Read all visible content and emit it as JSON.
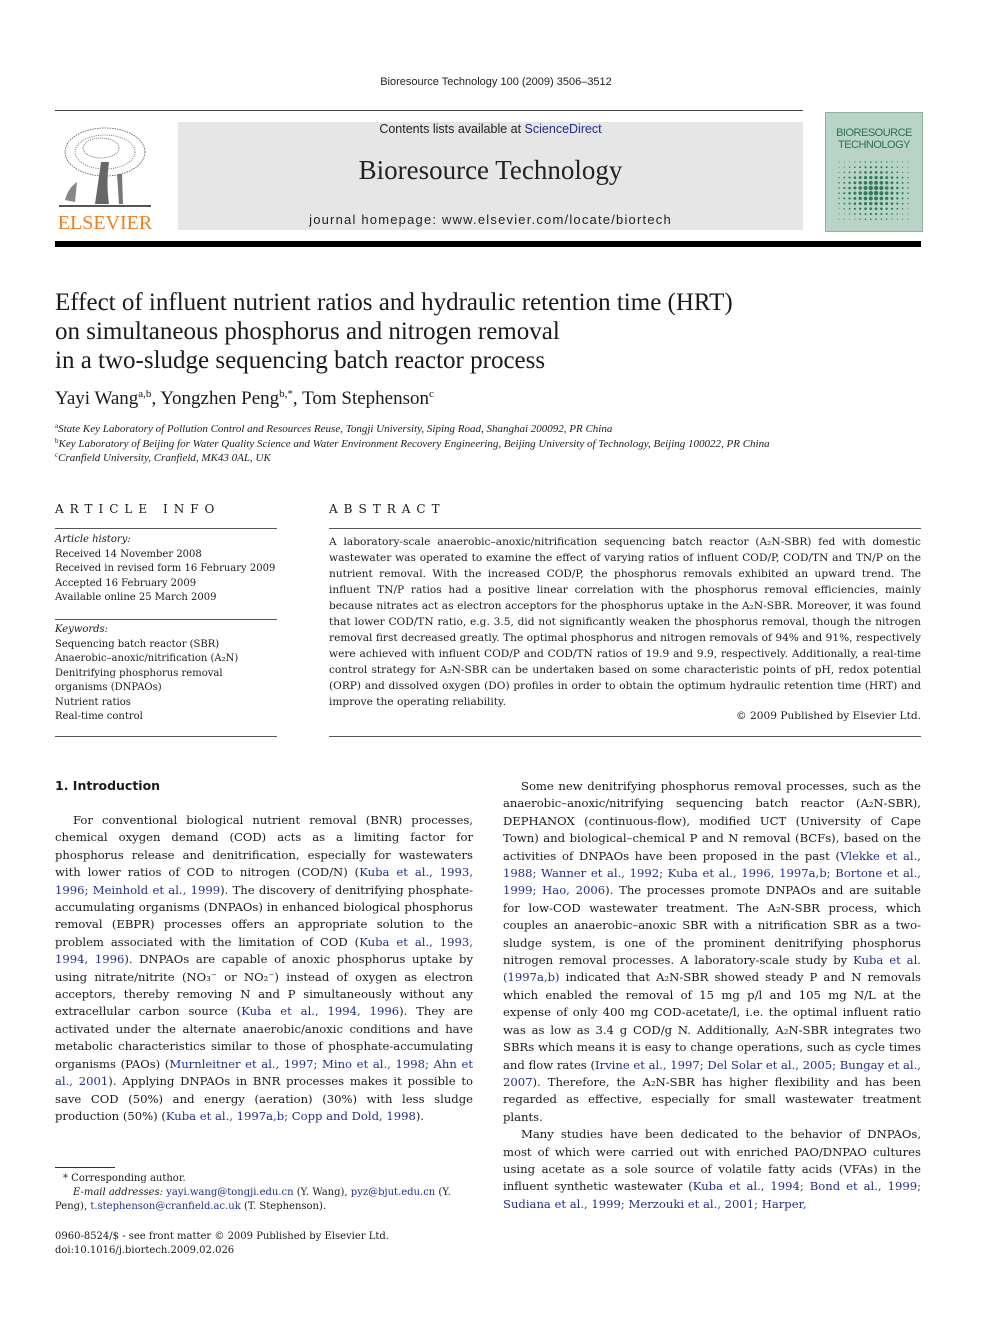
{
  "header": {
    "running_head": "Bioresource Technology 100 (2009) 3506–3512",
    "contents_prefix": "Contents lists available at ",
    "contents_link": "ScienceDirect",
    "journal_title": "Bioresource Technology",
    "homepage": "journal homepage: www.elsevier.com/locate/biortech",
    "publisher_logo_text": "ELSEVIER",
    "cover_title_line1": "BIORESOURCE",
    "cover_title_line2": "TECHNOLOGY",
    "colors": {
      "publisher_orange": "#f07f1c",
      "link_blue": "#1f2f8a",
      "cover_green": "#b7d4c6"
    }
  },
  "article": {
    "title_lines": [
      "Effect of influent nutrient ratios and hydraulic retention time (HRT)",
      "on simultaneous phosphorus and nitrogen removal",
      "in a two-sludge sequencing batch reactor process"
    ],
    "authors": [
      {
        "name": "Yayi Wang",
        "marks": "a,b",
        "sep": ", "
      },
      {
        "name": "Yongzhen Peng",
        "marks": "b,*",
        "sep": ", "
      },
      {
        "name": "Tom Stephenson",
        "marks": "c",
        "sep": ""
      }
    ],
    "affiliations": [
      {
        "mark": "a",
        "text": "State Key Laboratory of Pollution Control and Resources Reuse, Tongji University, Siping Road, Shanghai 200092, PR China"
      },
      {
        "mark": "b",
        "text": "Key Laboratory of Beijing for Water Quality Science and Water Environment Recovery Engineering, Beijing University of Technology, Beijing 100022, PR China"
      },
      {
        "mark": "c",
        "text": "Cranfield University, Cranfield, MK43 0AL, UK"
      }
    ]
  },
  "article_info": {
    "heading": "ARTICLE INFO",
    "history_label": "Article history:",
    "history": [
      "Received 14 November 2008",
      "Received in revised form 16 February 2009",
      "Accepted 16 February 2009",
      "Available online 25 March 2009"
    ],
    "keywords_label": "Keywords:",
    "keywords": [
      "Sequencing batch reactor (SBR)",
      "Anaerobic–anoxic/nitrification (A₂N)",
      "Denitrifying phosphorus removal organisms (DNPAOs)",
      "Nutrient ratios",
      "Real-time control"
    ]
  },
  "abstract": {
    "heading": "ABSTRACT",
    "text": "A laboratory-scale anaerobic–anoxic/nitrification sequencing batch reactor (A₂N-SBR) fed with domestic wastewater was operated to examine the effect of varying ratios of influent COD/P, COD/TN and TN/P on the nutrient removal. With the increased COD/P, the phosphorus removals exhibited an upward trend. The influent TN/P ratios had a positive linear correlation with the phosphorus removal efficiencies, mainly because nitrates act as electron acceptors for the phosphorus uptake in the A₂N-SBR. Moreover, it was found that lower COD/TN ratio, e.g. 3.5, did not significantly weaken the phosphorus removal, though the nitrogen removal first decreased greatly. The optimal phosphorus and nitrogen removals of 94% and 91%, respectively were achieved with influent COD/P and COD/TN ratios of 19.9 and 9.9, respectively. Additionally, a real-time control strategy for A₂N-SBR can be undertaken based on some characteristic points of pH, redox potential (ORP) and dissolved oxygen (DO) profiles in order to obtain the optimum hydraulic retention time (HRT) and improve the operating reliability.",
    "copyright": "© 2009 Published by Elsevier Ltd."
  },
  "body": {
    "section_heading": "1. Introduction",
    "left_paragraph": [
      {
        "t": "For conventional biological nutrient removal (BNR) processes, chemical oxygen demand (COD) acts as a limiting factor for phosphorus release and denitrification, especially for wastewaters with lower ratios of COD to nitrogen (COD/N) ("
      },
      {
        "link": "Kuba et al., 1993, 1996; Meinhold et al., 1999"
      },
      {
        "t": "). The discovery of denitrifying phosphate-accumulating organisms (DNPAOs) in enhanced biological phosphorus removal (EBPR) processes offers an appropriate solution to the problem associated with the limitation of COD ("
      },
      {
        "link": "Kuba et al., 1993, 1994, 1996"
      },
      {
        "t": "). DNPAOs are capable of anoxic phosphorus uptake by using nitrate/nitrite (NO₃⁻ or NO₂⁻) instead of oxygen as electron acceptors, thereby removing N and P simultaneously without any extracellular carbon source ("
      },
      {
        "link": "Kuba et al., 1994, 1996"
      },
      {
        "t": "). They are activated under the alternate anaerobic/anoxic conditions and have metabolic characteristics similar to those of phosphate-accumulating organisms (PAOs) ("
      },
      {
        "link": "Murnleitner et al., 1997; Mino et al., 1998; Ahn et al., 2001"
      },
      {
        "t": "). Applying DNPAOs in BNR processes makes it possible to save COD (50%) and energy (aeration) (30%) with less sludge production (50%) ("
      },
      {
        "link": "Kuba et al., 1997a,b; Copp and Dold, 1998"
      },
      {
        "t": ")."
      }
    ],
    "right_paragraph_1": [
      {
        "t": "Some new denitrifying phosphorus removal processes, such as the anaerobic–anoxic/nitrifying sequencing batch reactor (A₂N-SBR), DEPHANOX (continuous-flow), modified UCT (University of Cape Town) and biological–chemical P and N removal (BCFs), based on the activities of DNPAOs have been proposed in the past ("
      },
      {
        "link": "Vlekke et al., 1988; Wanner et al., 1992; Kuba et al., 1996, 1997a,b; Bortone et al., 1999; Hao, 2006"
      },
      {
        "t": "). The processes promote DNPAOs and are suitable for low-COD wastewater treatment. The A₂N-SBR process, which couples an anaerobic–anoxic SBR with a nitrification SBR as a two-sludge system, is one of the prominent denitrifying phosphorus nitrogen removal processes. A laboratory-scale study by "
      },
      {
        "link": "Kuba et al. (1997a,b)"
      },
      {
        "t": " indicated that A₂N-SBR showed steady P and N removals which enabled the removal of 15 mg p/l and 105 mg N/L at the expense of only 400 mg COD-acetate/l, i.e. the optimal influent ratio was as low as 3.4 g COD/g N. Additionally, A₂N-SBR integrates two SBRs which means it is easy to change operations, such as cycle times and flow rates ("
      },
      {
        "link": "Irvine et al., 1997; Del Solar et al., 2005; Bungay et al., 2007"
      },
      {
        "t": "). Therefore, the A₂N-SBR has higher flexibility and has been regarded as effective, especially for small wastewater treatment plants."
      }
    ],
    "right_paragraph_2": [
      {
        "t": "Many studies have been dedicated to the behavior of DNPAOs, most of which were carried out with enriched PAO/DNPAO cultures using acetate as a sole source of volatile fatty acids (VFAs) in the influent synthetic wastewater ("
      },
      {
        "link": "Kuba et al., 1994; Bond et al., 1999; Sudiana et al., 1999; Merzouki et al., 2001; Harper,"
      }
    ]
  },
  "footnotes": {
    "corresponding": "* Corresponding author.",
    "email_label": "E-mail addresses:",
    "emails": [
      {
        "addr": "yayi.wang@tongji.edu.cn",
        "who": " (Y. Wang), "
      },
      {
        "addr": "pyz@bjut.edu.cn",
        "who": " (Y. Peng), "
      },
      {
        "addr": "t.stephenson@cranfield.ac.uk",
        "who": " (T. Stephenson)."
      }
    ],
    "issn": "0960-8524/$ - see front matter © 2009 Published by Elsevier Ltd.",
    "doi": "doi:10.1016/j.biortech.2009.02.026"
  }
}
